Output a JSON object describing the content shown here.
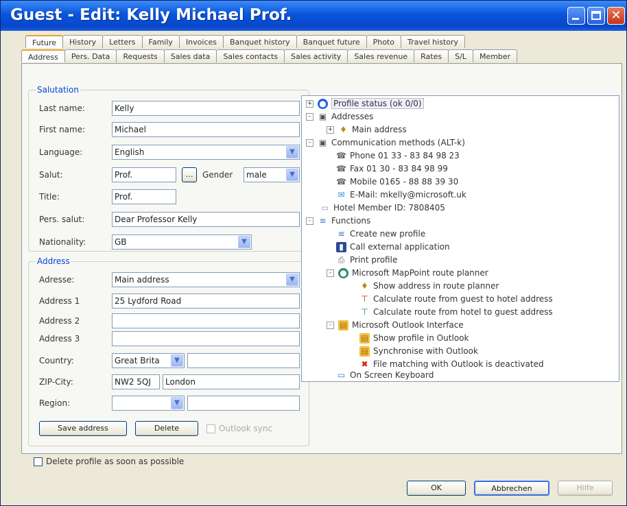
{
  "window": {
    "title": "Guest - Edit: Kelly Michael Prof."
  },
  "tabs_row1": [
    "Future",
    "History",
    "Letters",
    "Family",
    "Invoices",
    "Banquet history",
    "Banquet future",
    "Photo",
    "Travel history"
  ],
  "tabs_row2": [
    "Address",
    "Pers. Data",
    "Requests",
    "Sales data",
    "Sales contacts",
    "Sales activity",
    "Sales revenue",
    "Rates",
    "S/L",
    "Member"
  ],
  "salutation": {
    "legend": "Salutation",
    "last_name_label": "Last name:",
    "last_name": "Kelly",
    "first_name_label": "First name:",
    "first_name": "Michael",
    "language_label": "Language:",
    "language": "English",
    "salut_label": "Salut:",
    "salut": "Prof.",
    "gender_label": "Gender",
    "gender": "male",
    "title_label": "Title:",
    "title": "Prof.",
    "pers_salut_label": "Pers. salut:",
    "pers_salut": "Dear Professor Kelly",
    "nationality_label": "Nationality:",
    "nationality": "GB"
  },
  "address": {
    "legend": "Address",
    "address_label": "Adresse:",
    "address": "Main address",
    "line1_label": "Address 1",
    "line1": "25 Lydford Road",
    "line2_label": "Address 2",
    "line2": "",
    "line3_label": "Address 3",
    "line3": "",
    "country_label": "Country:",
    "country": "Great Brita",
    "zip_label": "ZIP-City:",
    "zip": "NW2 5QJ",
    "city": "London",
    "region_label": "Region:",
    "region": "",
    "save_btn": "Save address",
    "delete_btn": "Delete",
    "outlook_sync": "Outlook sync"
  },
  "tree": [
    {
      "text": "Profile status (ok 0/0)",
      "icon": "globe-icon",
      "exp": "+"
    },
    {
      "text": "Addresses",
      "icon": "addresses-icon",
      "exp": "-"
    },
    {
      "text": "Main address",
      "icon": "address-pin-icon",
      "exp": "+"
    },
    {
      "text": "Communication methods (ALT-k)",
      "icon": "communication-icon",
      "exp": "-"
    },
    {
      "text": "Phone 01 33 - 83 84 98 23",
      "icon": "phone-icon",
      "exp": ""
    },
    {
      "text": "Fax 01 30 - 83 84 98 99",
      "icon": "fax-icon",
      "exp": ""
    },
    {
      "text": "Mobile 0165 - 88 88 39 30",
      "icon": "mobile-icon",
      "exp": ""
    },
    {
      "text": "E-Mail: mkelly@microsoft.uk",
      "icon": "email-icon",
      "exp": ""
    },
    {
      "text": "Hotel Member ID: 7808405",
      "icon": "member-card-icon",
      "exp": ""
    },
    {
      "text": "Functions",
      "icon": "functions-icon",
      "exp": "-"
    },
    {
      "text": "Create new profile",
      "icon": "new-profile-icon",
      "exp": ""
    },
    {
      "text": "Call external application",
      "icon": "external-app-icon",
      "exp": ""
    },
    {
      "text": "Print profile",
      "icon": "print-icon",
      "exp": ""
    },
    {
      "text": "Microsoft MapPoint route planner",
      "icon": "mappoint-icon",
      "exp": "-"
    },
    {
      "text": "Show address in route planner",
      "icon": "route-pin-icon",
      "exp": ""
    },
    {
      "text": "Calculate route from guest to hotel address",
      "icon": "route-icon",
      "exp": ""
    },
    {
      "text": "Calculate route from hotel to guest address",
      "icon": "route-icon",
      "exp": ""
    },
    {
      "text": "Microsoft Outlook Interface",
      "icon": "outlook-folder-icon",
      "exp": "-"
    },
    {
      "text": "Show profile in Outlook",
      "icon": "outlook-folder-icon",
      "exp": ""
    },
    {
      "text": "Synchronise with Outlook",
      "icon": "outlook-folder-icon",
      "exp": ""
    },
    {
      "text": "File matching with Outlook is deactivated",
      "icon": "deactivated-x-icon",
      "exp": ""
    },
    {
      "text": "On Screen Keyboard",
      "icon": "keyboard-icon",
      "exp": ""
    }
  ],
  "delete_profile": "Delete profile as soon as possible",
  "buttons": {
    "ok": "OK",
    "cancel": "Abbrechen",
    "help": "Hilfe"
  }
}
